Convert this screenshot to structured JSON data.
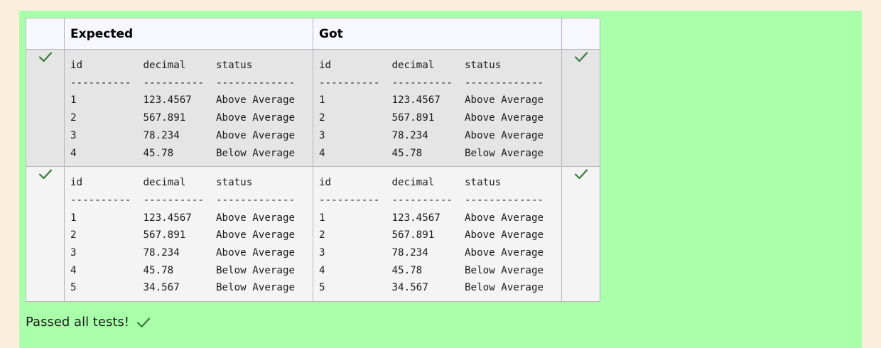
{
  "table": {
    "headers": {
      "mark_left": "",
      "expected": "Expected",
      "got": "Got",
      "mark_right": ""
    },
    "rows": [
      {
        "expected": "id          decimal     status\n----------  ----------  -------------\n1           123.4567    Above Average\n2           567.891     Above Average\n3           78.234      Above Average\n4           45.78       Below Average",
        "got": "id          decimal     status\n----------  ----------  -------------\n1           123.4567    Above Average\n2           567.891     Above Average\n3           78.234      Above Average\n4           45.78       Below Average",
        "result_icon": "check-icon"
      },
      {
        "expected": "id          decimal     status\n----------  ----------  -------------\n1           123.4567    Above Average\n2           567.891     Above Average\n3           78.234      Above Average\n4           45.78       Below Average\n5           34.567      Below Average",
        "got": "id          decimal     status\n----------  ----------  -------------\n1           123.4567    Above Average\n2           567.891     Above Average\n3           78.234      Above Average\n4           45.78       Below Average\n5           34.567      Below Average",
        "result_icon": "check-icon"
      }
    ]
  },
  "summary": {
    "text": "Passed all tests!",
    "icon": "check-icon"
  },
  "colors": {
    "page_bg": "#fbefdc",
    "pass_bg": "#aaffaa",
    "check": "#3a7a3a"
  }
}
